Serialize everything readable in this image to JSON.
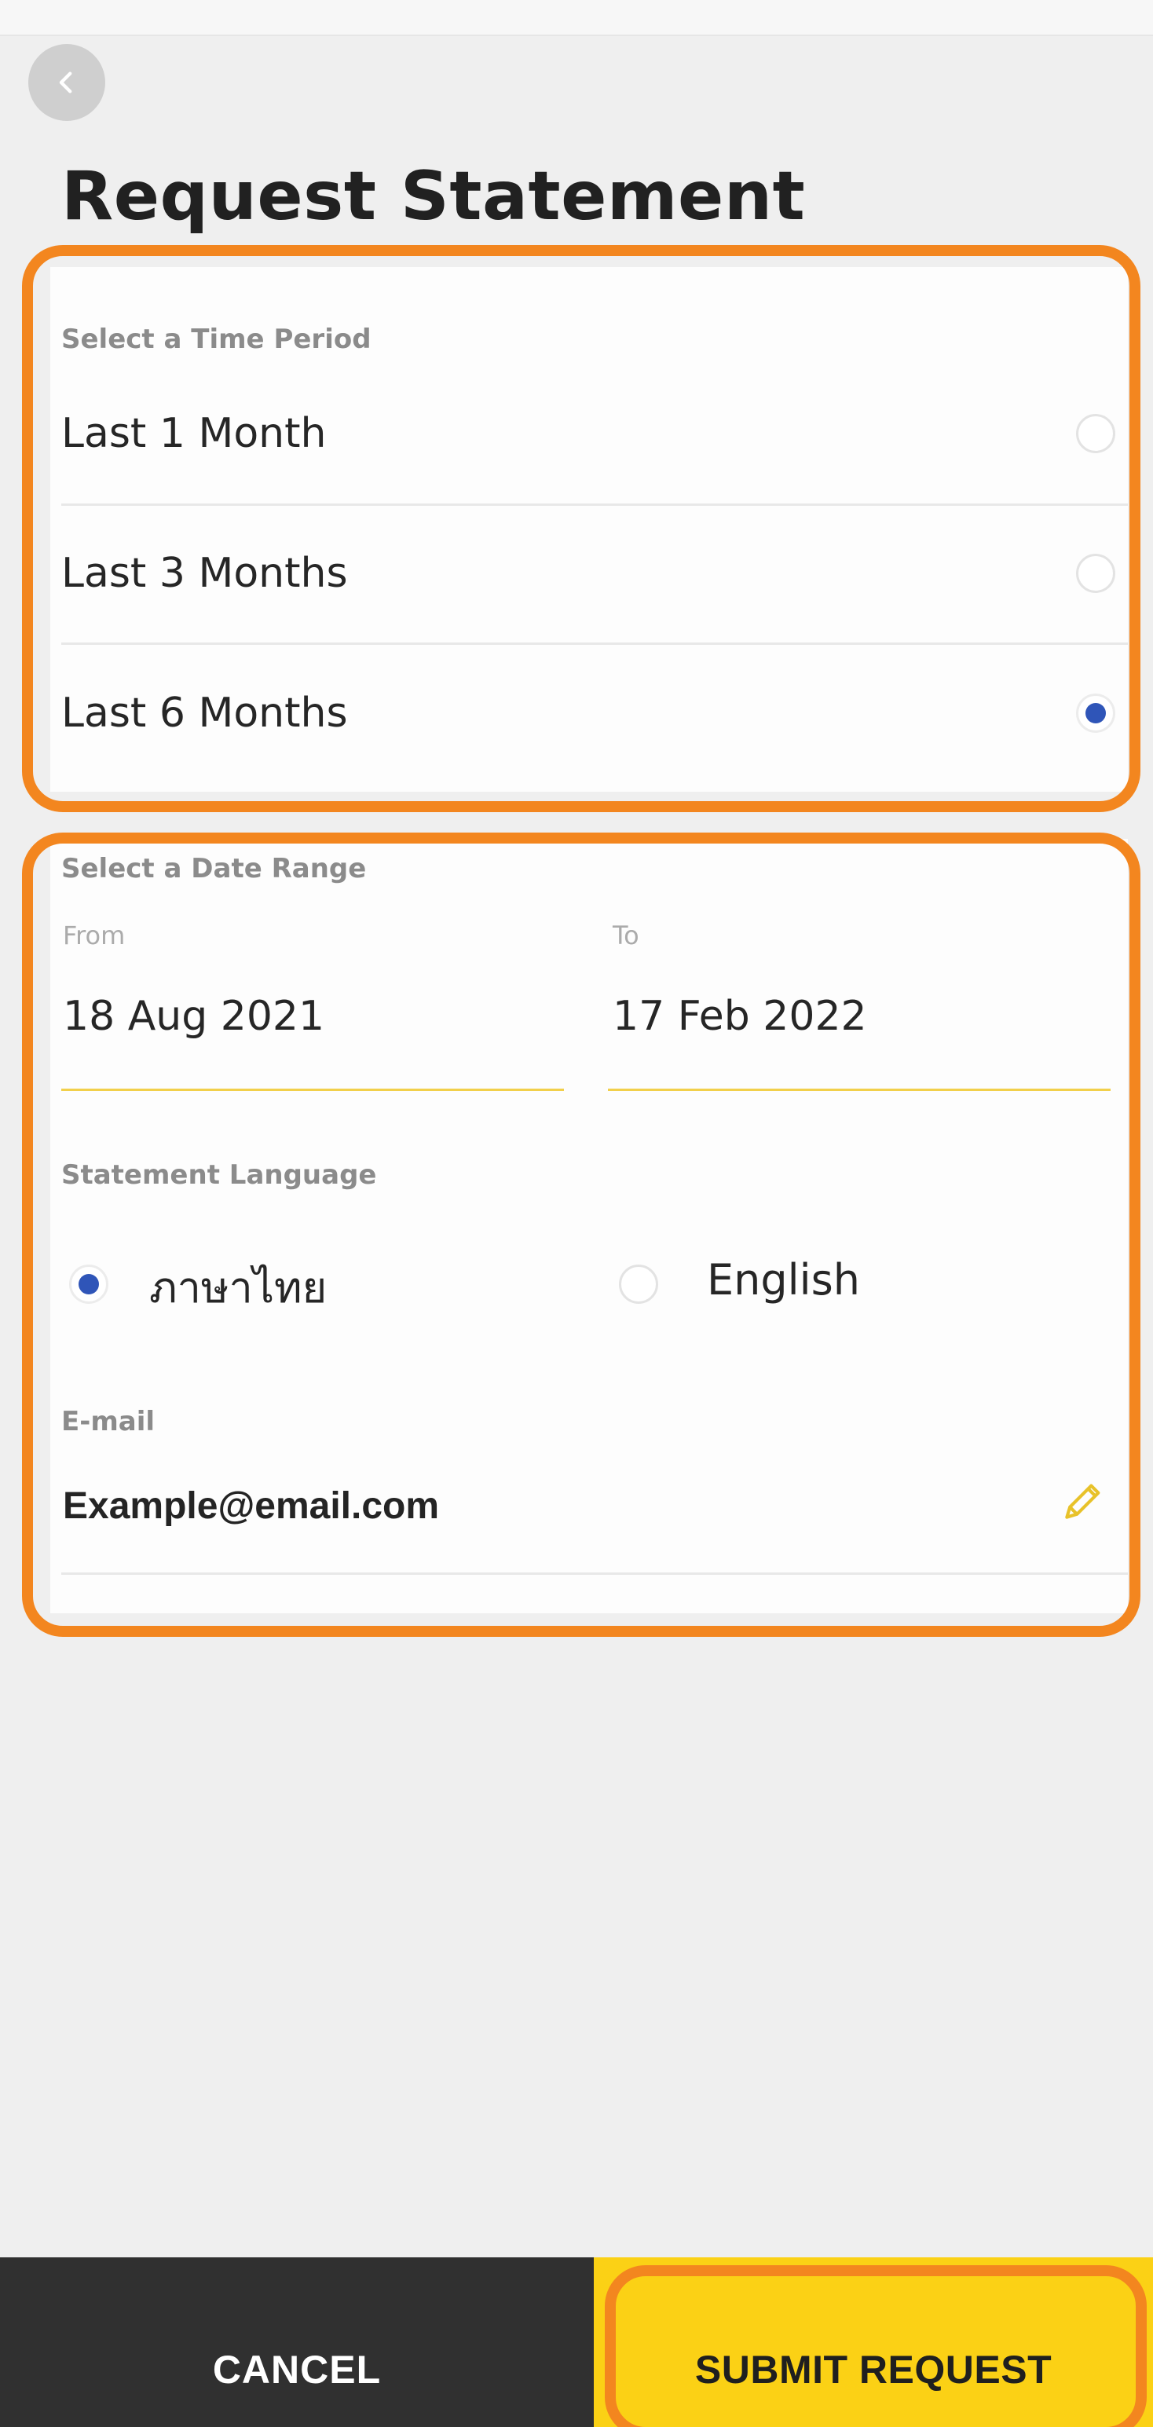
{
  "header": {
    "back_icon": "chevron-left-icon",
    "title": "Request Statement"
  },
  "time_period": {
    "label": "Select a Time Period",
    "options": [
      {
        "label": "Last 1 Month",
        "selected": false
      },
      {
        "label": "Last 3 Months",
        "selected": false
      },
      {
        "label": "Last 6 Months",
        "selected": true
      }
    ]
  },
  "date_range": {
    "label": "Select a Date Range",
    "from_label": "From",
    "from_value": "18 Aug 2021",
    "to_label": "To",
    "to_value": "17 Feb 2022"
  },
  "language": {
    "label": "Statement Language",
    "options": [
      {
        "label": "ภาษาไทย",
        "selected": true
      },
      {
        "label": "English",
        "selected": false
      }
    ]
  },
  "email": {
    "label": "E-mail",
    "value": "Example@email.com",
    "edit_icon": "pencil-icon"
  },
  "footer": {
    "cancel_label": "CANCEL",
    "submit_label": "SUBMIT REQUEST"
  },
  "colors": {
    "accent_blue": "#2f55b8",
    "highlight_orange": "#f3861f",
    "submit_yellow": "#fbd115",
    "cancel_dark": "#303030",
    "underline_yellow": "#f2d04b"
  }
}
